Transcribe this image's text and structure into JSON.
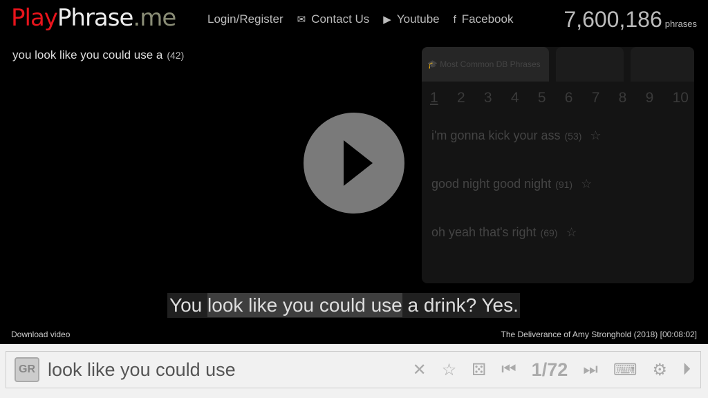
{
  "header": {
    "logo": {
      "part1": "Play",
      "part2": "Phrase",
      "part3": ".me"
    },
    "nav": [
      {
        "label": "Login/Register",
        "icon": ""
      },
      {
        "label": "Contact Us",
        "icon": "envelope-icon"
      },
      {
        "label": "Youtube",
        "icon": "youtube-icon"
      },
      {
        "label": "Facebook",
        "icon": "facebook-icon"
      }
    ],
    "phrase_count": "7,600,186",
    "phrase_unit": "phrases"
  },
  "current": {
    "phrase": "you look like you could use a",
    "count": "(42)"
  },
  "panel": {
    "tabs": [
      "Most Common DB Phrases"
    ],
    "pages": [
      "1",
      "2",
      "3",
      "4",
      "5",
      "6",
      "7",
      "8",
      "9",
      "10"
    ],
    "items": [
      {
        "text": "i'm gonna kick your ass",
        "count": "(53)"
      },
      {
        "text": "good night good night",
        "count": "(91)"
      },
      {
        "text": "oh yeah that's right",
        "count": "(69)"
      }
    ]
  },
  "subtitle": {
    "before": "You ",
    "highlight": "look like you could use",
    "after": " a drink? Yes."
  },
  "download_label": "Download video",
  "source": "The Deliverance of Amy Stronghold (2018) [00:08:02]",
  "search": {
    "lang": "GR",
    "value": "look like you could use",
    "counter": "1/72"
  }
}
